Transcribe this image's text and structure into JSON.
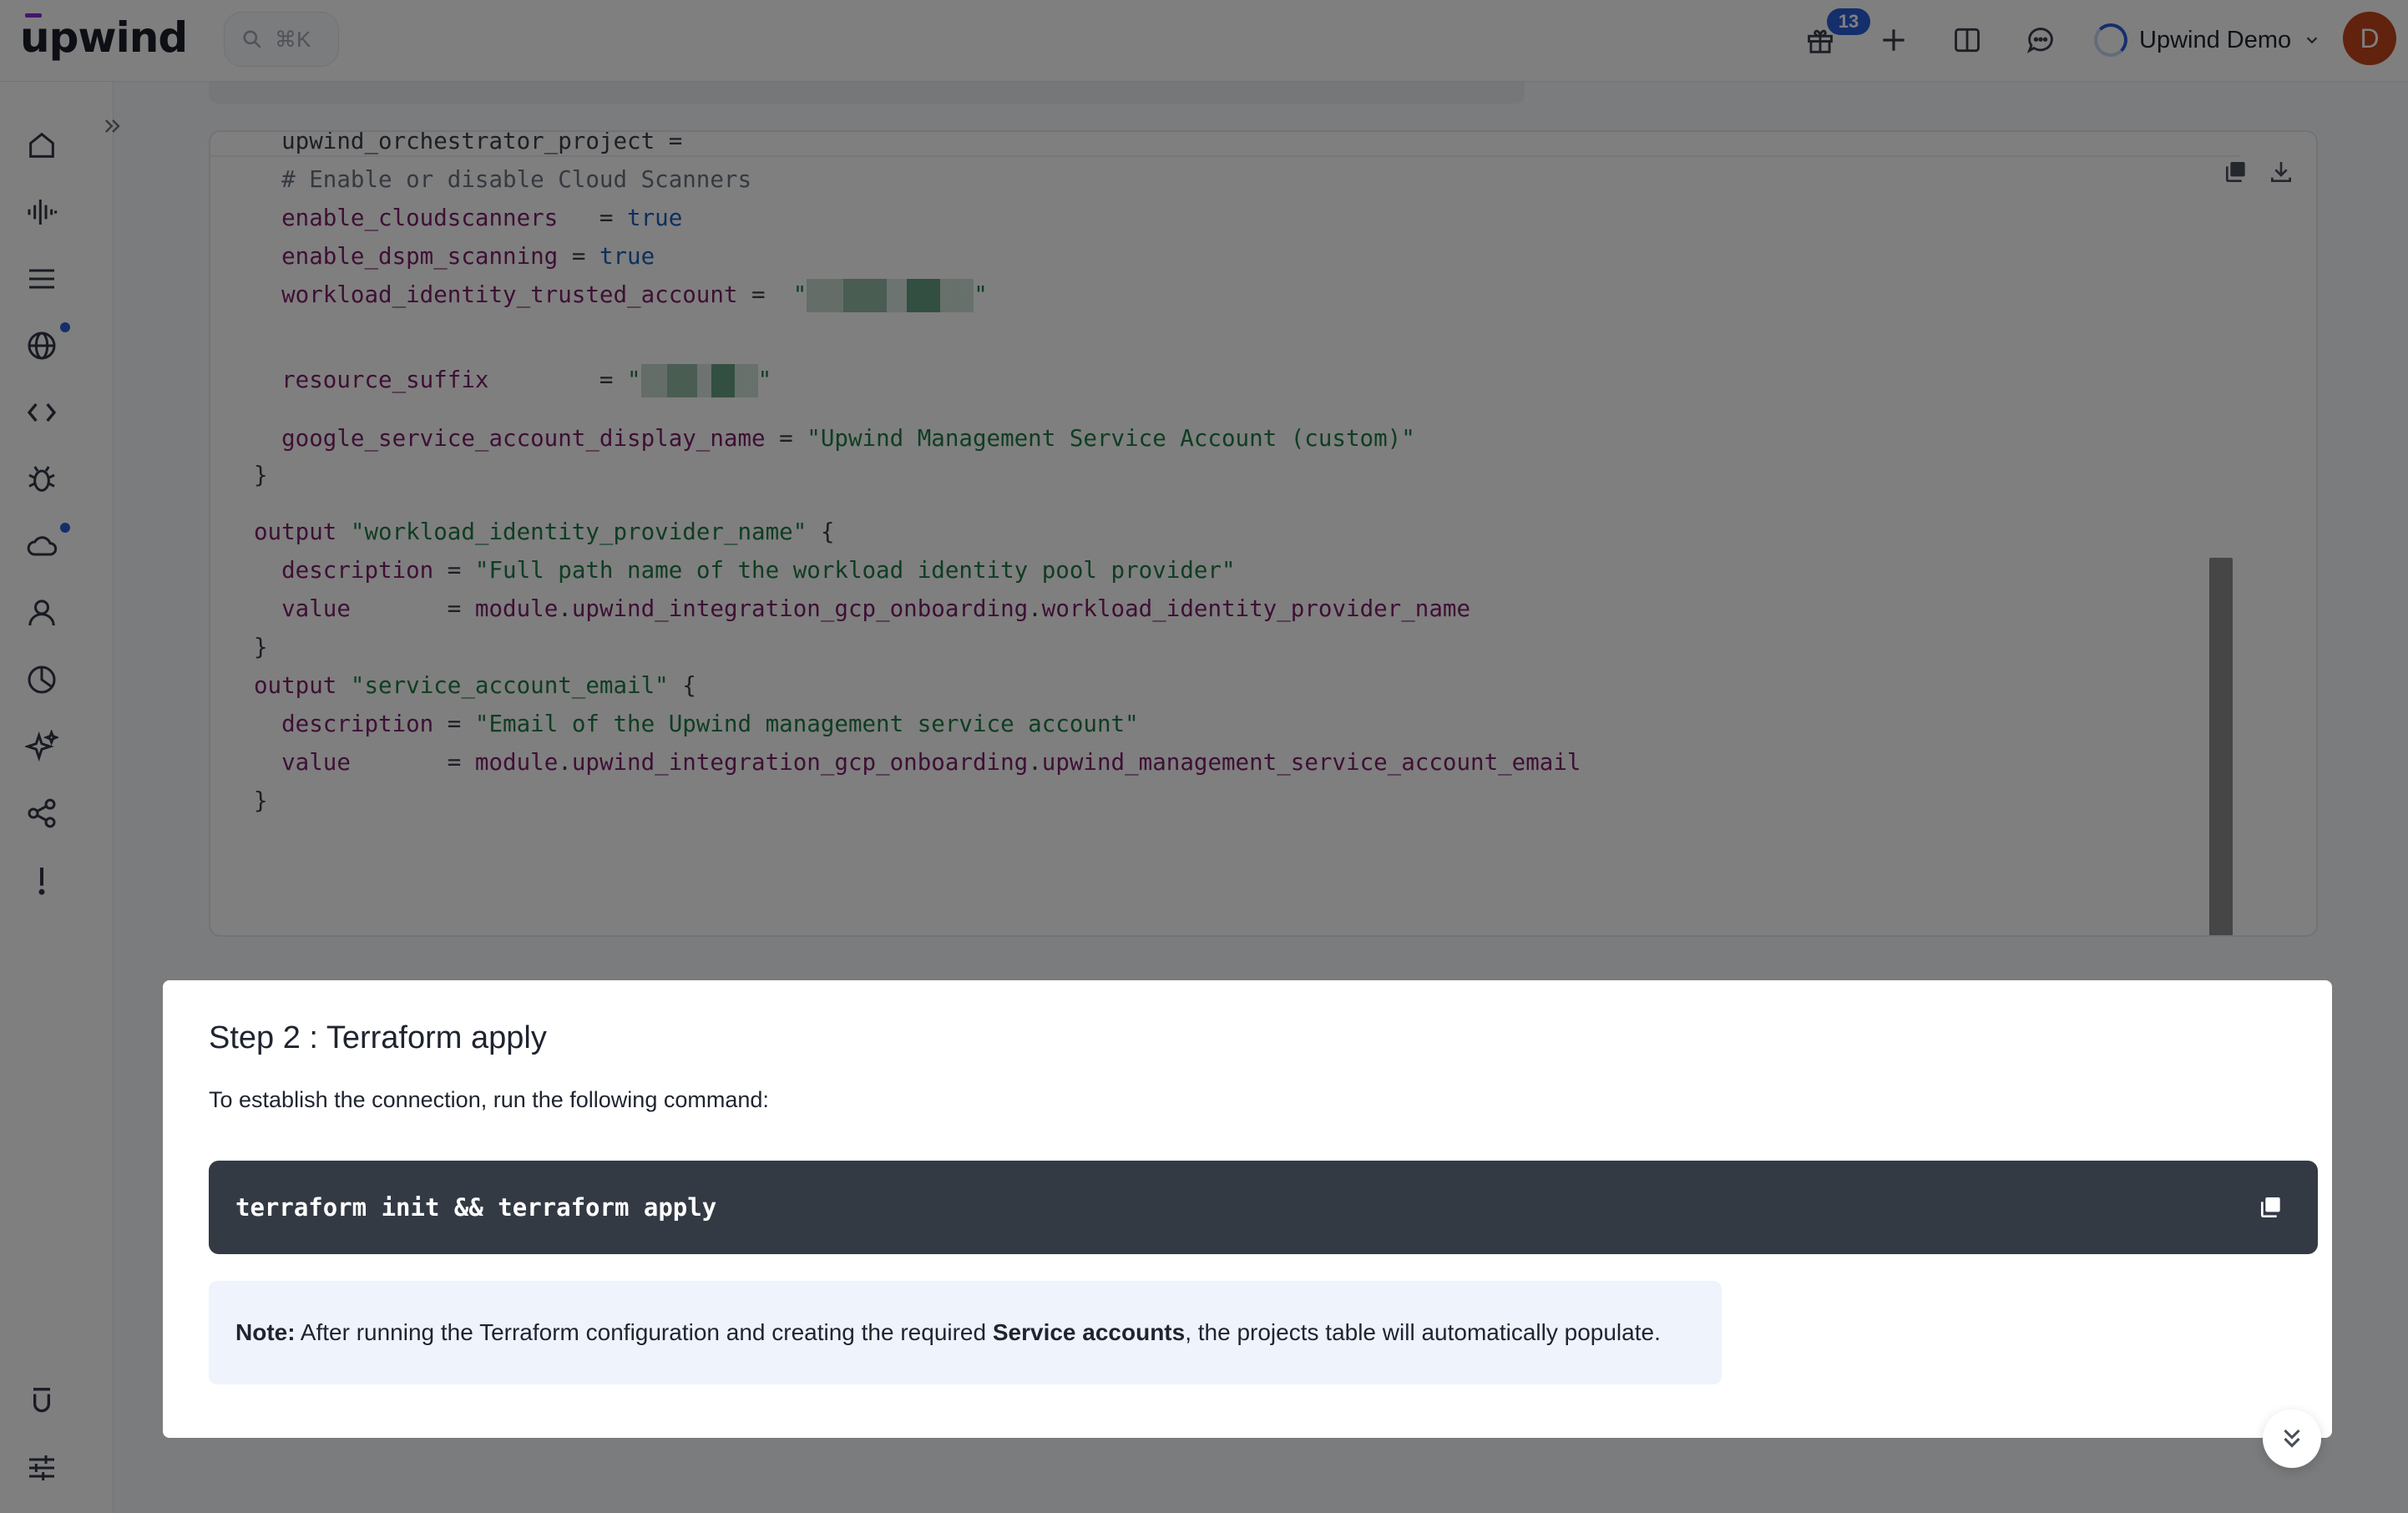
{
  "header": {
    "logo_text": "upwind",
    "search_shortcut": "⌘K",
    "notifications_count": "13",
    "org_name": "Upwind Demo",
    "avatar_initial": "D",
    "icons": [
      "gift-icon",
      "plus-icon",
      "book-icon",
      "chat-icon",
      "chevron-down-icon"
    ]
  },
  "sidebar": {
    "items": [
      {
        "name": "home",
        "icon": "home-icon"
      },
      {
        "name": "activity",
        "icon": "waveform-icon"
      },
      {
        "name": "inventory",
        "icon": "list-icon"
      },
      {
        "name": "network",
        "icon": "globe-icon",
        "has_dot": true
      },
      {
        "name": "code",
        "icon": "code-icon"
      },
      {
        "name": "vulnerabilities",
        "icon": "bug-icon"
      },
      {
        "name": "cloud",
        "icon": "cloud-icon",
        "has_dot": true
      },
      {
        "name": "identities",
        "icon": "user-icon"
      },
      {
        "name": "reports",
        "icon": "pie-chart-icon"
      },
      {
        "name": "ai",
        "icon": "sparkles-icon"
      },
      {
        "name": "integrations",
        "icon": "share-icon"
      },
      {
        "name": "alerts",
        "icon": "exclamation-icon"
      }
    ],
    "bottom_items": [
      {
        "name": "upwind",
        "icon": "upwind-u-icon"
      },
      {
        "name": "settings",
        "icon": "sliders-icon"
      }
    ]
  },
  "code_panel": {
    "lines": [
      {
        "segments": [
          {
            "t": "  upwind_orchestrator_project = ",
            "c": "pl"
          }
        ]
      },
      {
        "segments": [
          {
            "t": "  # Enable or disable Cloud Scanners",
            "c": "cmt"
          }
        ]
      },
      {
        "segments": [
          {
            "t": "  enable_cloudscanners   ",
            "c": "id"
          },
          {
            "t": "= ",
            "c": "pl"
          },
          {
            "t": "true",
            "c": "kw"
          }
        ]
      },
      {
        "segments": [
          {
            "t": "  enable_dspm_scanning ",
            "c": "id"
          },
          {
            "t": "= ",
            "c": "pl"
          },
          {
            "t": "true",
            "c": "kw"
          }
        ]
      },
      {
        "segments": [
          {
            "t": "  workload_identity_trusted_account ",
            "c": "id"
          },
          {
            "t": "=  ",
            "c": "pl"
          },
          {
            "t": "\"",
            "c": "str"
          },
          {
            "blur": 200
          },
          {
            "t": "\"",
            "c": "str"
          }
        ]
      },
      {
        "segments": [
          {
            "t": "  resource_suffix        ",
            "c": "id"
          },
          {
            "t": "= ",
            "c": "pl"
          },
          {
            "t": "\"",
            "c": "str"
          },
          {
            "blur": 140
          },
          {
            "t": "\"",
            "c": "str"
          }
        ]
      },
      {
        "segments": [
          {
            "t": "  google_service_account_display_name ",
            "c": "id"
          },
          {
            "t": "= ",
            "c": "pl"
          },
          {
            "t": "\"Upwind Management Service Account (custom)\"",
            "c": "str"
          }
        ]
      },
      {
        "segments": [
          {
            "t": "}",
            "c": "pl"
          }
        ]
      },
      {
        "segments": [
          {
            "t": "output ",
            "c": "id"
          },
          {
            "t": "\"workload_identity_provider_name\"",
            "c": "str"
          },
          {
            "t": " {",
            "c": "pl"
          }
        ]
      },
      {
        "segments": [
          {
            "t": "  description ",
            "c": "id"
          },
          {
            "t": "= ",
            "c": "pl"
          },
          {
            "t": "\"Full path name of the workload identity pool provider\"",
            "c": "str"
          }
        ]
      },
      {
        "segments": [
          {
            "t": "  value       ",
            "c": "id"
          },
          {
            "t": "= ",
            "c": "pl"
          },
          {
            "t": "module",
            "c": "id"
          },
          {
            "t": ".",
            "c": "pl"
          },
          {
            "t": "upwind_integration_gcp_onboarding",
            "c": "id"
          },
          {
            "t": ".",
            "c": "pl"
          },
          {
            "t": "workload_identity_provider_name",
            "c": "id"
          }
        ]
      },
      {
        "segments": [
          {
            "t": "}",
            "c": "pl"
          }
        ]
      },
      {
        "segments": [
          {
            "t": "output ",
            "c": "id"
          },
          {
            "t": "\"service_account_email\"",
            "c": "str"
          },
          {
            "t": " {",
            "c": "pl"
          }
        ]
      },
      {
        "segments": [
          {
            "t": "  description ",
            "c": "id"
          },
          {
            "t": "= ",
            "c": "pl"
          },
          {
            "t": "\"Email of the Upwind management service account\"",
            "c": "str"
          }
        ]
      },
      {
        "segments": [
          {
            "t": "  value       ",
            "c": "id"
          },
          {
            "t": "= ",
            "c": "pl"
          },
          {
            "t": "module",
            "c": "id"
          },
          {
            "t": ".",
            "c": "pl"
          },
          {
            "t": "upwind_integration_gcp_onboarding",
            "c": "id"
          },
          {
            "t": ".",
            "c": "pl"
          },
          {
            "t": "upwind_management_service_account_email",
            "c": "id"
          }
        ]
      },
      {
        "segments": [
          {
            "t": "}",
            "c": "pl"
          }
        ]
      }
    ],
    "tools": [
      "copy-icon",
      "download-icon"
    ]
  },
  "modal": {
    "title": "Step 2 : Terraform apply",
    "description": "To establish the connection, run the following command:",
    "command": "terraform init && terraform apply",
    "note_label": "Note:",
    "note_before": " After running the Terraform configuration and creating the required ",
    "note_bold": "Service accounts",
    "note_after": ", the projects table will automatically populate."
  },
  "colors": {
    "accent": "#2b5fd9",
    "brand_purple": "#8b2bd6",
    "avatar": "#c3441c",
    "command_bg": "#343a44",
    "note_bg": "#eef3fc"
  }
}
